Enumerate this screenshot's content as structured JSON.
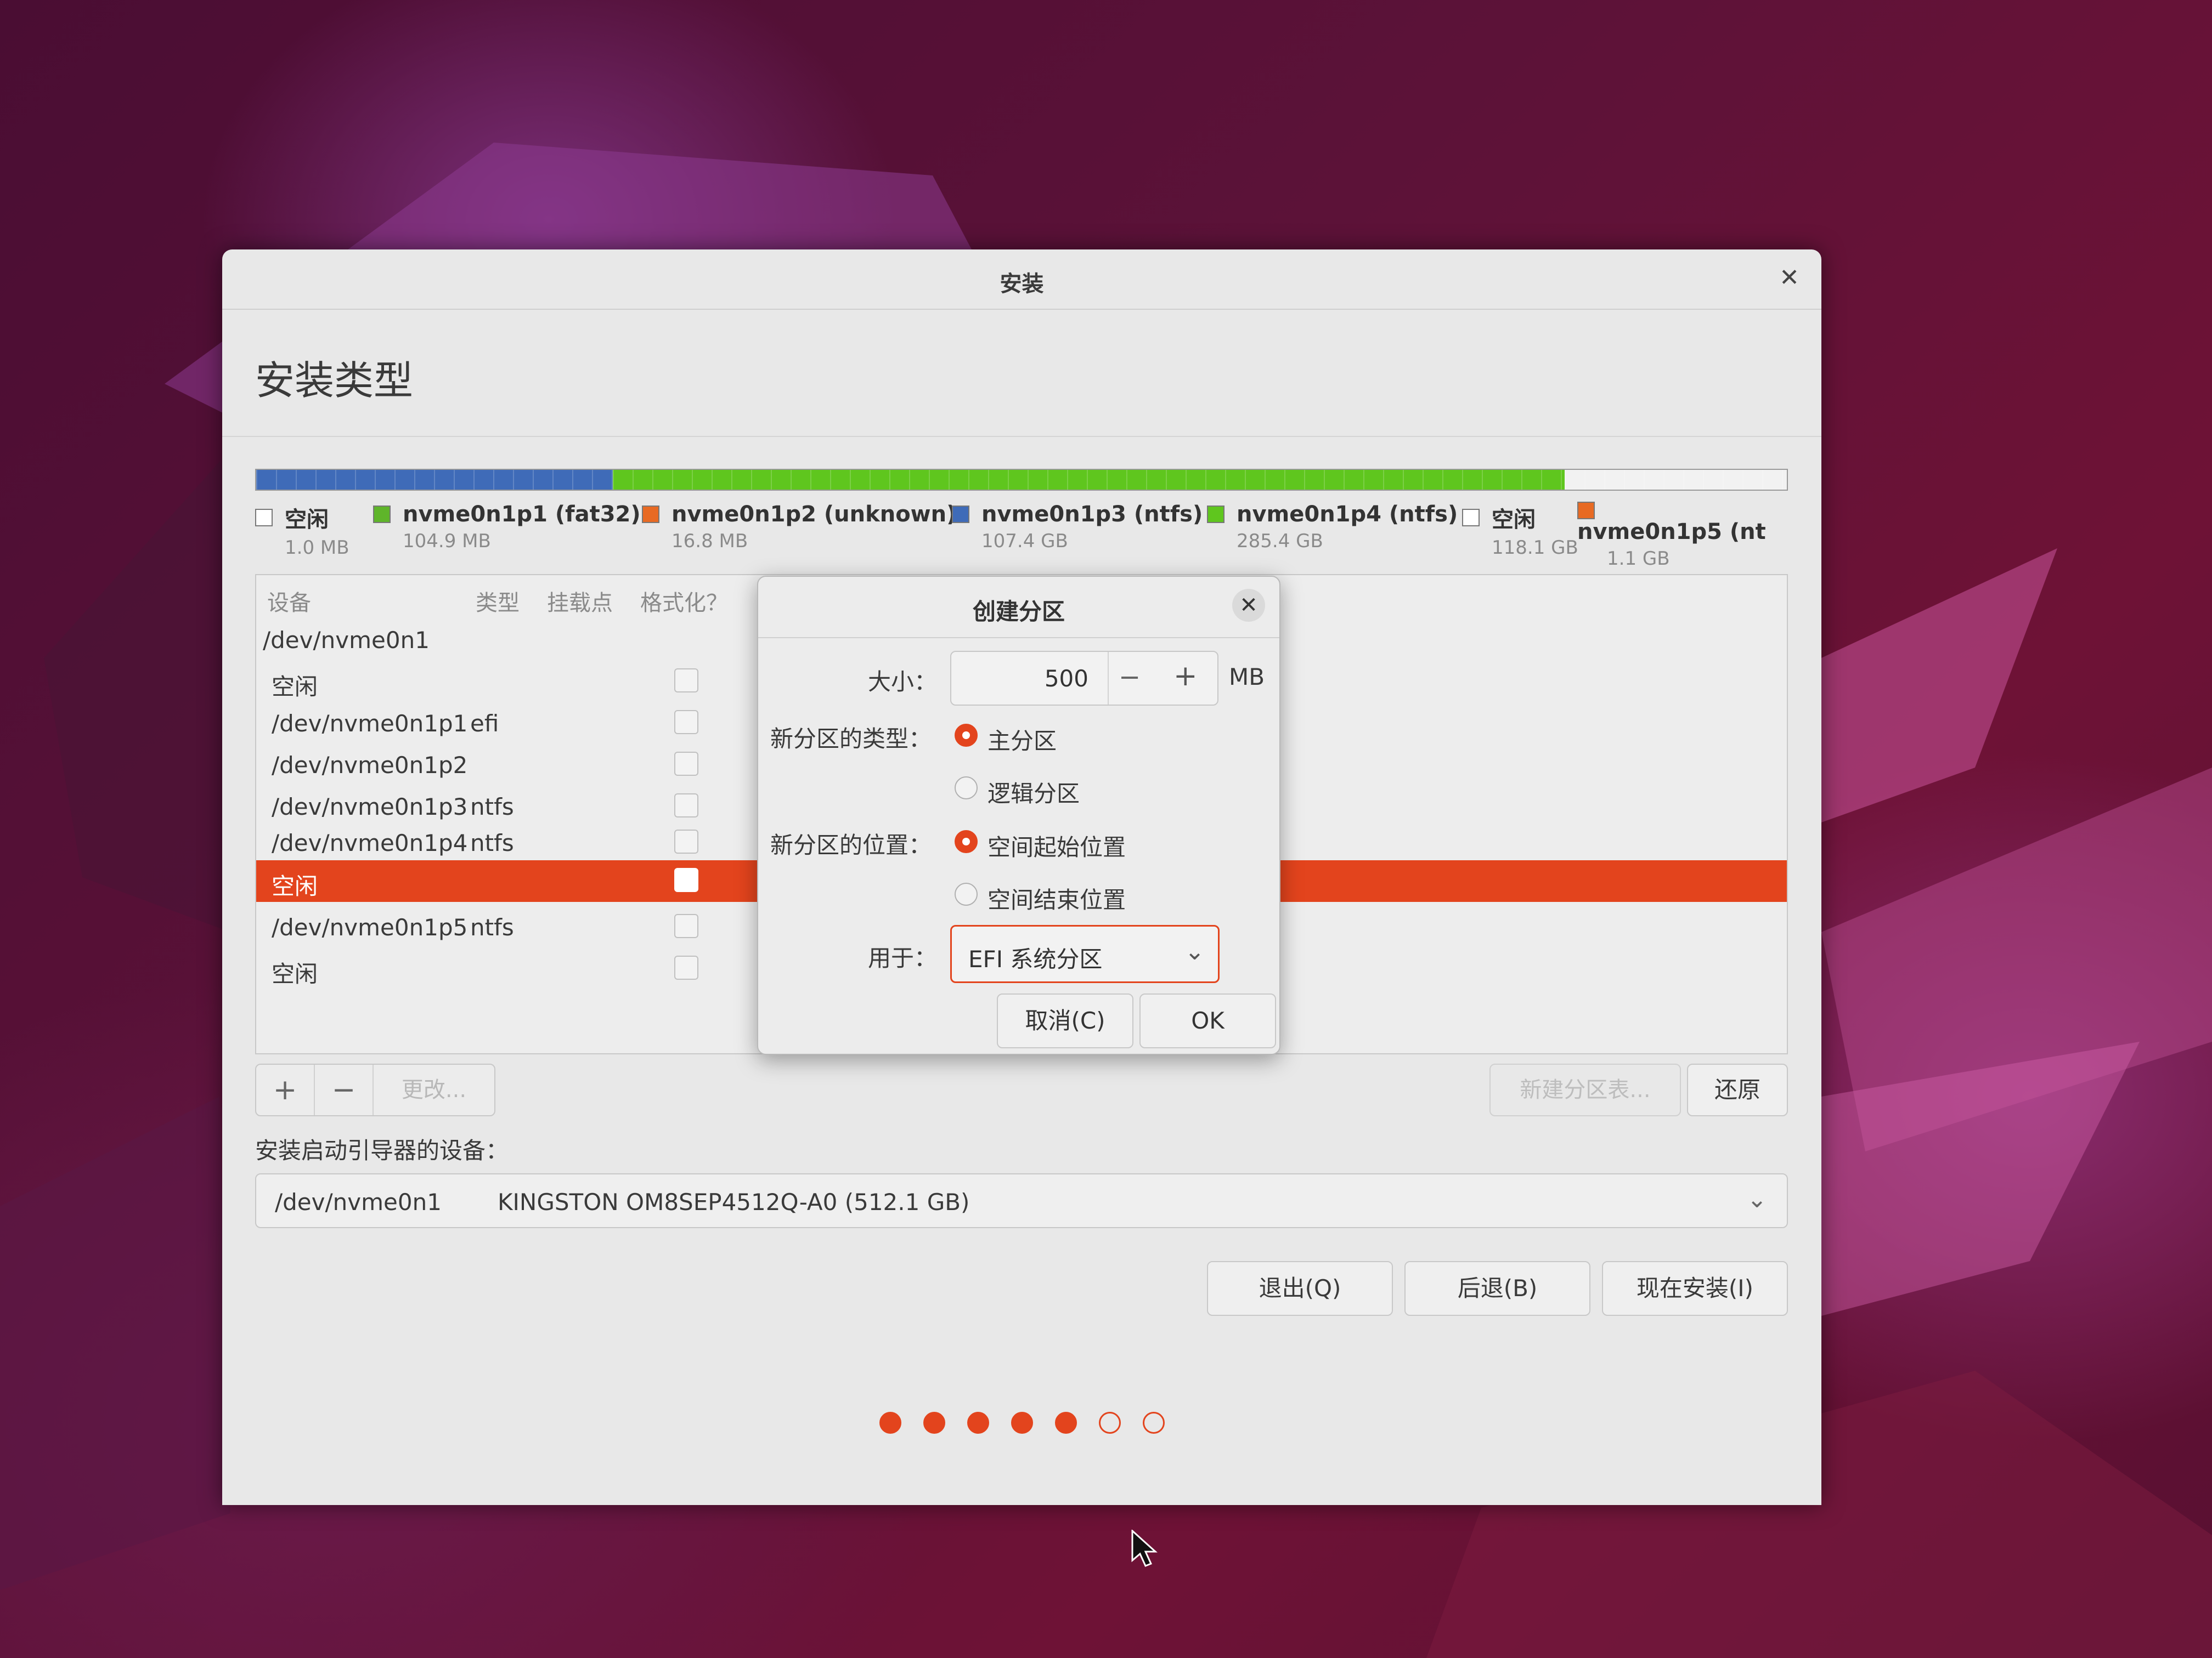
{
  "window": {
    "title": "安装",
    "heading": "安装类型"
  },
  "legend": [
    {
      "name": "空闲",
      "size": "1.0 MB",
      "color": "#ffffff"
    },
    {
      "name": "nvme0n1p1 (fat32)",
      "size": "104.9 MB",
      "color": "#5fb52a"
    },
    {
      "name": "nvme0n1p2 (unknown)",
      "size": "16.8 MB",
      "color": "#e86a23"
    },
    {
      "name": "nvme0n1p3 (ntfs)",
      "size": "107.4 GB",
      "color": "#3f6bb8"
    },
    {
      "name": "nvme0n1p4 (ntfs)",
      "size": "285.4 GB",
      "color": "#5fc61e"
    },
    {
      "name": "空闲",
      "size": "118.1 GB",
      "color": "#ffffff"
    },
    {
      "name": "nvme0n1p5 (nt",
      "size": "1.1 GB",
      "color": "#e86a23"
    }
  ],
  "table": {
    "headers": {
      "device": "设备",
      "type": "类型",
      "mount": "挂载点",
      "format": "格式化？"
    },
    "group": "/dev/nvme0n1",
    "rows": [
      {
        "device": "空闲",
        "type": ""
      },
      {
        "device": "/dev/nvme0n1p1",
        "type": "efi"
      },
      {
        "device": "/dev/nvme0n1p2",
        "type": ""
      },
      {
        "device": "/dev/nvme0n1p3",
        "type": "ntfs"
      },
      {
        "device": "/dev/nvme0n1p4",
        "type": "ntfs"
      },
      {
        "device": "空闲",
        "type": "",
        "selected": true
      },
      {
        "device": "/dev/nvme0n1p5",
        "type": "ntfs"
      },
      {
        "device": "空闲",
        "type": ""
      }
    ]
  },
  "toolbar": {
    "add": "+",
    "remove": "−",
    "change": "更改..."
  },
  "new_table_label": "新建分区表...",
  "revert_label": "还原",
  "boot": {
    "label": "安装启动引导器的设备：",
    "device": "/dev/nvme0n1",
    "model": "KINGSTON OM8SEP4512Q-A0 (512.1 GB)"
  },
  "nav": {
    "quit": "退出(Q)",
    "back": "后退(B)",
    "install": "现在安装(I)"
  },
  "progress": {
    "total": 7,
    "filled": 5
  },
  "dialog": {
    "title": "创建分区",
    "size_label": "大小：",
    "size_value": "500",
    "size_unit": "MB",
    "type_label": "新分区的类型：",
    "type_primary": "主分区",
    "type_logical": "逻辑分区",
    "location_label": "新分区的位置：",
    "location_start": "空间起始位置",
    "location_end": "空间结束位置",
    "use_label": "用于：",
    "use_value": "EFI 系统分区",
    "cancel": "取消(C)",
    "ok": "OK"
  },
  "colors": {
    "accent": "#e3441d"
  }
}
